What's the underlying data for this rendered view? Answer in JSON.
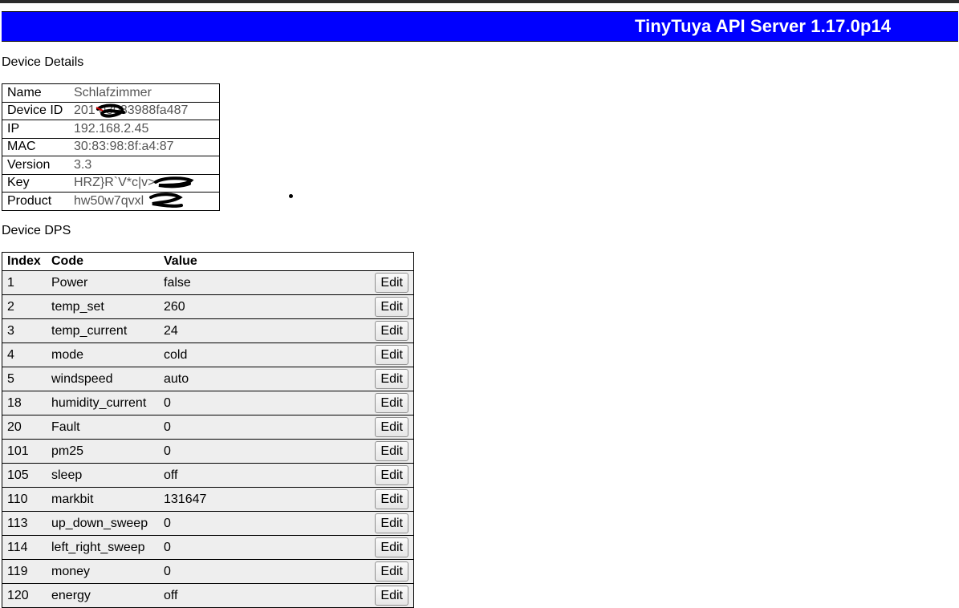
{
  "header": {
    "title": "TinyTuya API Server 1.17.0p14"
  },
  "device_details": {
    "section_label": "Device Details",
    "rows": [
      {
        "key": "Name",
        "value": "Schlafzimmer"
      },
      {
        "key": "Device ID",
        "value": "201          03083988fa487"
      },
      {
        "key": "IP",
        "value": "192.168.2.45"
      },
      {
        "key": "MAC",
        "value": "30:83:98:8f:a4:87"
      },
      {
        "key": "Version",
        "value": "3.3"
      },
      {
        "key": "Key",
        "value": "HRZ}R`V*c|v>"
      },
      {
        "key": "Product",
        "value": "hw50w7qvxl"
      }
    ]
  },
  "device_dps": {
    "section_label": "Device DPS",
    "columns": {
      "index": "Index",
      "code": "Code",
      "value": "Value"
    },
    "edit_label": "Edit",
    "rows": [
      {
        "index": "1",
        "code": "Power",
        "value": "false"
      },
      {
        "index": "2",
        "code": "temp_set",
        "value": "260"
      },
      {
        "index": "3",
        "code": "temp_current",
        "value": "24"
      },
      {
        "index": "4",
        "code": "mode",
        "value": "cold"
      },
      {
        "index": "5",
        "code": "windspeed",
        "value": "auto"
      },
      {
        "index": "18",
        "code": "humidity_current",
        "value": "0"
      },
      {
        "index": "20",
        "code": "Fault",
        "value": "0"
      },
      {
        "index": "101",
        "code": "pm25",
        "value": "0"
      },
      {
        "index": "105",
        "code": "sleep",
        "value": "off"
      },
      {
        "index": "110",
        "code": "markbit",
        "value": "131647"
      },
      {
        "index": "113",
        "code": "up_down_sweep",
        "value": "0"
      },
      {
        "index": "114",
        "code": "left_right_sweep",
        "value": "0"
      },
      {
        "index": "119",
        "code": "money",
        "value": "0"
      },
      {
        "index": "120",
        "code": "energy",
        "value": "off"
      }
    ]
  },
  "colors": {
    "header_bg": "#0000ff",
    "header_text": "#ffffff",
    "row_bg": "#eeeeee",
    "detail_value_text": "#555555"
  }
}
